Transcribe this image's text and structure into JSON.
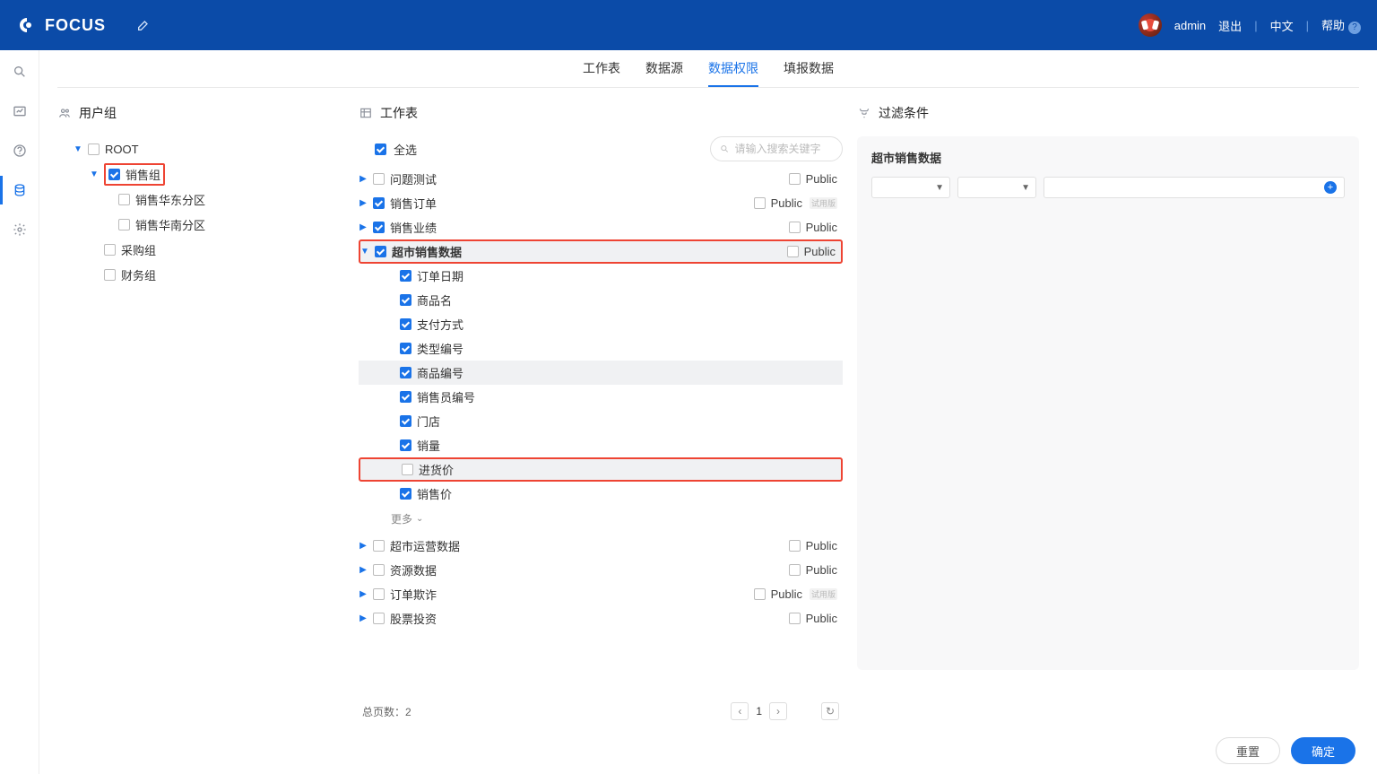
{
  "header": {
    "brand": "FOCUS",
    "username": "admin",
    "logout": "退出",
    "lang": "中文",
    "help": "帮助"
  },
  "tabs": [
    {
      "label": "工作表",
      "active": false
    },
    {
      "label": "数据源",
      "active": false
    },
    {
      "label": "数据权限",
      "active": true
    },
    {
      "label": "填报数据",
      "active": false
    }
  ],
  "columns": {
    "users_title": "用户组",
    "tables_title": "工作表",
    "filters_title": "过滤条件"
  },
  "user_tree": [
    {
      "level": 0,
      "caret": "down",
      "checked": false,
      "label": "ROOT",
      "highlight": false
    },
    {
      "level": 1,
      "caret": "down",
      "checked": true,
      "label": "销售组",
      "highlight": true
    },
    {
      "level": 2,
      "caret": "none",
      "checked": false,
      "label": "销售华东分区",
      "highlight": false
    },
    {
      "level": 2,
      "caret": "none",
      "checked": false,
      "label": "销售华南分区",
      "highlight": false
    },
    {
      "level": 1,
      "caret": "none",
      "checked": false,
      "label": "采购组",
      "highlight": false
    },
    {
      "level": 1,
      "caret": "none",
      "checked": false,
      "label": "财务组",
      "highlight": false
    }
  ],
  "tables": {
    "select_all": "全选",
    "search_placeholder": "请输入搜索关键字",
    "more_label": "更多",
    "list": [
      {
        "level": 0,
        "caret": "right",
        "checked": false,
        "label": "问题测试",
        "public": true,
        "public_label": "Public",
        "highlight": false
      },
      {
        "level": 0,
        "caret": "right",
        "checked": true,
        "label": "销售订单",
        "public": true,
        "public_label": "Public",
        "highlight": false,
        "tag": "试用版"
      },
      {
        "level": 0,
        "caret": "right",
        "checked": true,
        "label": "销售业绩",
        "public": true,
        "public_label": "Public",
        "highlight": false
      },
      {
        "level": 0,
        "caret": "down",
        "checked": true,
        "label": "超市销售数据",
        "public": true,
        "public_label": "Public",
        "highlight": true
      },
      {
        "level": 1,
        "caret": "none",
        "checked": true,
        "label": "订单日期",
        "public": false,
        "highlight": false
      },
      {
        "level": 1,
        "caret": "none",
        "checked": true,
        "label": "商品名",
        "public": false,
        "highlight": false
      },
      {
        "level": 1,
        "caret": "none",
        "checked": true,
        "label": "支付方式",
        "public": false,
        "highlight": false
      },
      {
        "level": 1,
        "caret": "none",
        "checked": true,
        "label": "类型编号",
        "public": false,
        "highlight": false
      },
      {
        "level": 1,
        "caret": "none",
        "checked": true,
        "label": "商品编号",
        "public": false,
        "highlight": false,
        "selected": true
      },
      {
        "level": 1,
        "caret": "none",
        "checked": true,
        "label": "销售员编号",
        "public": false,
        "highlight": false
      },
      {
        "level": 1,
        "caret": "none",
        "checked": true,
        "label": "门店",
        "public": false,
        "highlight": false
      },
      {
        "level": 1,
        "caret": "none",
        "checked": true,
        "label": "销量",
        "public": false,
        "highlight": false
      },
      {
        "level": 1,
        "caret": "none",
        "checked": false,
        "label": "进货价",
        "public": false,
        "highlight": true
      },
      {
        "level": 1,
        "caret": "none",
        "checked": true,
        "label": "销售价",
        "public": false,
        "highlight": false
      },
      {
        "level": -1,
        "more": true
      },
      {
        "level": 0,
        "caret": "right",
        "checked": false,
        "label": "超市运营数据",
        "public": true,
        "public_label": "Public",
        "highlight": false
      },
      {
        "level": 0,
        "caret": "right",
        "checked": false,
        "label": "资源数据",
        "public": true,
        "public_label": "Public",
        "highlight": false
      },
      {
        "level": 0,
        "caret": "right",
        "checked": false,
        "label": "订单欺诈",
        "public": true,
        "public_label": "Public",
        "highlight": false,
        "tag": "试用版"
      },
      {
        "level": 0,
        "caret": "right",
        "checked": false,
        "label": "股票投资",
        "public": true,
        "public_label": "Public",
        "highlight": false
      }
    ]
  },
  "pager": {
    "total_label": "总页数：2",
    "current": "1"
  },
  "filter": {
    "title": "超市销售数据"
  },
  "footer": {
    "reset": "重置",
    "ok": "确定"
  }
}
